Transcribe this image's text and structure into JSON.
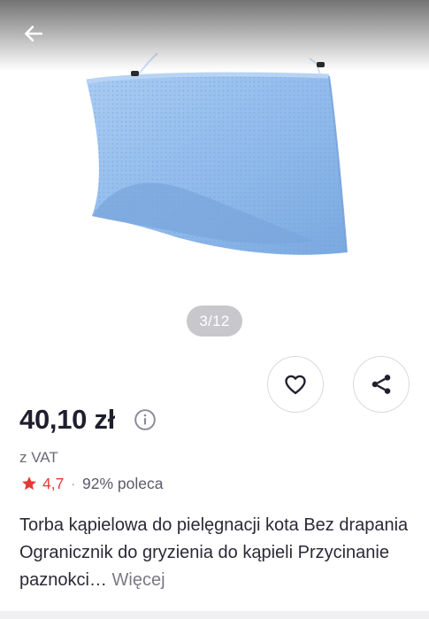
{
  "gallery": {
    "counter": "3/12",
    "image_color": "#8db8ea"
  },
  "actions": {
    "back_icon": "arrow-left-icon",
    "favorite_icon": "heart-outline-icon",
    "share_icon": "share-icon"
  },
  "product": {
    "price": "40,10 zł",
    "vat": "z VAT",
    "rating": "4,7",
    "separator": "·",
    "recommend": "92% poleca",
    "title": "Torba kąpielowa do pielęgnacji kota Bez drapania Ogranicznik do gryzienia do kąpieli Przycinanie paznokci…",
    "more_label": "Więcej"
  },
  "colors": {
    "accent_red": "#e53935",
    "price_text": "#1f1f2e",
    "counter_bg": "#c8c8cc"
  }
}
